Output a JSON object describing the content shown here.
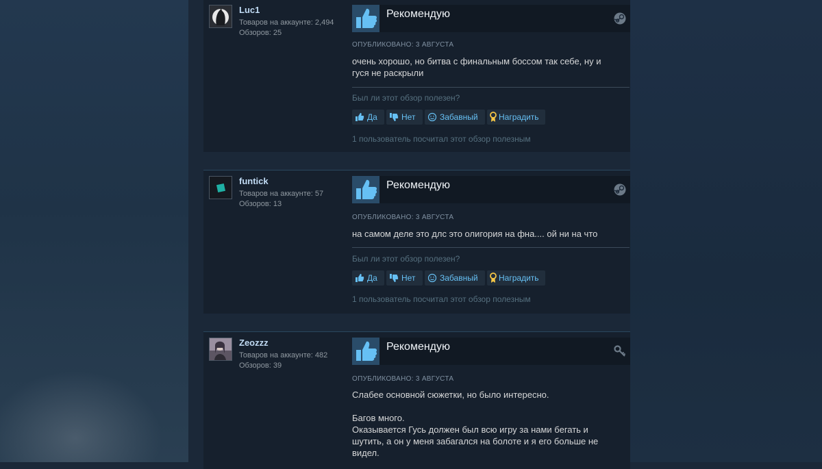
{
  "reviews": [
    {
      "author": {
        "name": "Luc1",
        "products_line": "Товаров на аккаунте: 2,494",
        "reviews_line": "Обзоров: 25"
      },
      "verdict": "Рекомендую",
      "posted": "ОПУБЛИКОВАНО: 3 АВГУСТА",
      "text": [
        "очень хорошо, но битва с финальным боссом так себе, ну и гуся не раскрыли"
      ],
      "helpful_question": "Был ли этот обзор полезен?",
      "buttons": {
        "yes": "Да",
        "no": "Нет",
        "funny": "Забавный",
        "award": "Наградить"
      },
      "helpful_count": "1 пользователь посчитал этот обзор полезным",
      "product_icon": "steam-icon"
    },
    {
      "author": {
        "name": "funtick",
        "products_line": "Товаров на аккаунте: 57",
        "reviews_line": "Обзоров: 13"
      },
      "verdict": "Рекомендую",
      "posted": "ОПУБЛИКОВАНО: 3 АВГУСТА",
      "text": [
        "на самом деле это длс это олигория на фна.... ой ни на что"
      ],
      "helpful_question": "Был ли этот обзор полезен?",
      "buttons": {
        "yes": "Да",
        "no": "Нет",
        "funny": "Забавный",
        "award": "Наградить"
      },
      "helpful_count": "1 пользователь посчитал этот обзор полезным",
      "product_icon": "steam-icon"
    },
    {
      "author": {
        "name": "Zeozzz",
        "products_line": "Товаров на аккаунте: 482",
        "reviews_line": "Обзоров: 39"
      },
      "verdict": "Рекомендую",
      "posted": "ОПУБЛИКОВАНО: 3 АВГУСТА",
      "text": [
        "Слабее основной сюжетки, но было интересно.",
        "Багов много.",
        "Оказывается Гусь должен был всю игру за нами бегать и шутить, а он у меня забагался на болоте и я его больше не видел."
      ],
      "product_icon": "key-icon"
    }
  ],
  "colors": {
    "link": "#66c0f4",
    "author": "#c1dbf4",
    "background": "#1b2838",
    "panel": "#16202d"
  }
}
